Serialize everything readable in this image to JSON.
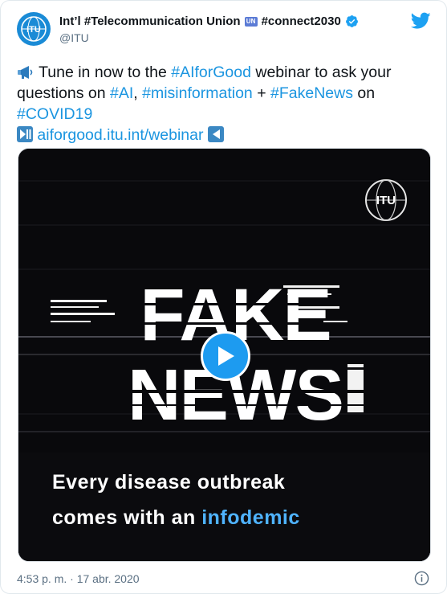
{
  "account": {
    "name": "Int’l #Telecommunication Union",
    "badge": "UN",
    "name_suffix": "#connect2030",
    "handle": "@ITU"
  },
  "tweet": {
    "line1_pre": "Tune in now to the ",
    "line1_tag": "#AIforGood",
    "line1_post": " webinar to ask your",
    "line2_pre": "questions on ",
    "line2_tag1": "#AI",
    "line2_mid": ", ",
    "line2_tag2": "#misinformation",
    "line2_plus": " + ",
    "line2_tag3": "#FakeNews",
    "line2_post": " on",
    "line3_tag": "#COVID19",
    "link": "aiforgood.itu.int/webinar"
  },
  "media": {
    "logo_text": "ITU",
    "headline_1": "FAKE",
    "headline_2": "NEWS",
    "caption_line1": "Every disease outbreak",
    "caption_line2_pre": "comes with an ",
    "caption_line2_highlight": "infodemic"
  },
  "meta": {
    "timestamp": "4:53 p. m. · 17 abr. 2020"
  },
  "icons": {
    "megaphone": "megaphone-icon",
    "play_pause": "play-pause-icon",
    "reverse": "reverse-button-icon",
    "bird": "twitter-bird-icon",
    "verified": "verified-icon",
    "info": "info-icon",
    "play": "play-icon"
  },
  "colors": {
    "link": "#1b95e0",
    "verified": "#1da1f2",
    "play_button": "#1d9bf0",
    "highlight": "#4fb3ff"
  }
}
